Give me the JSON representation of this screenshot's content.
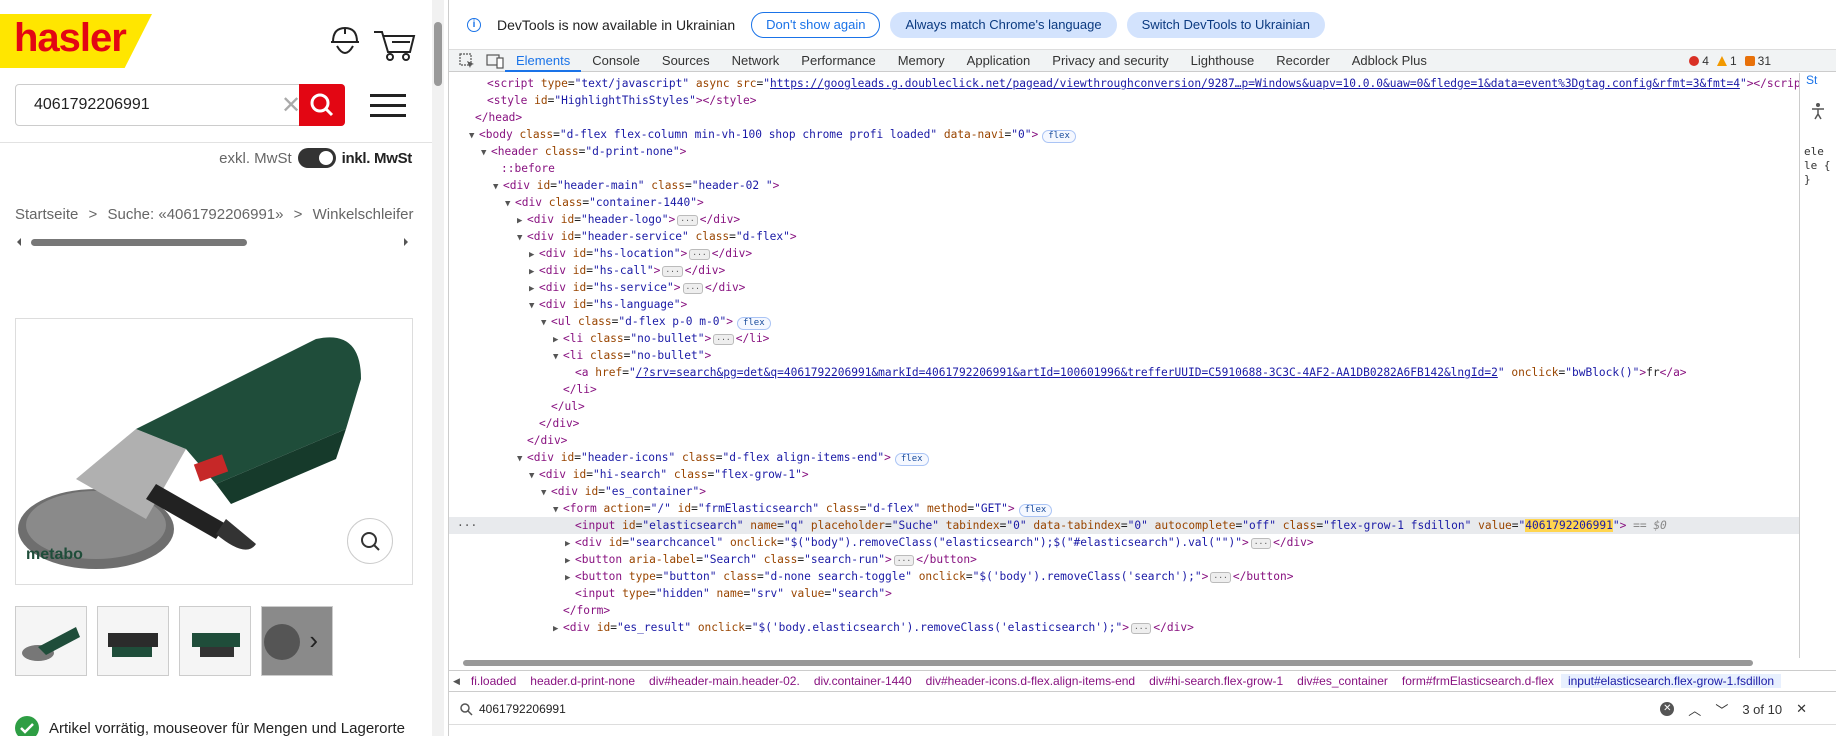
{
  "shop": {
    "logo_text": "hasler",
    "search_value": "4061792206991",
    "vat_exclusive": "exkl. MwSt",
    "vat_inclusive": "inkl. MwSt",
    "breadcrumbs": [
      "Startseite",
      ">",
      "Suche: «4061792206991»",
      ">",
      "Winkelschleifer Al"
    ],
    "stock_text": "Artikel vorrätig, mouseover für Mengen und Lagerorte",
    "brand_on_product": "metabo"
  },
  "devtools": {
    "info_text": "DevTools is now available in Ukrainian",
    "info_buttons": [
      "Don't show again",
      "Always match Chrome's language",
      "Switch DevTools to Ukrainian"
    ],
    "tabs": [
      "Elements",
      "Console",
      "Sources",
      "Network",
      "Performance",
      "Memory",
      "Application",
      "Privacy and security",
      "Lighthouse",
      "Recorder",
      "Adblock Plus"
    ],
    "error_count": "4",
    "warning_count": "1",
    "issue_count": "31",
    "side_tab": "St",
    "side_lines": [
      "ele",
      "le {",
      "}"
    ],
    "breadcrumb_path": [
      "fi.loaded",
      "header.d-print-none",
      "div#header-main.header-02.",
      "div.container-1440",
      "div#header-icons.d-flex.align-items-end",
      "div#hi-search.flex-grow-1",
      "div#es_container",
      "form#frmElasticsearch.d-flex",
      "input#elasticsearch.flex-grow-1.fsdillon"
    ],
    "find_value": "4061792206991",
    "find_count": "3 of 10",
    "flex_badge": "flex",
    "dollar_zero": "== $0"
  },
  "dom": {
    "l0_src": "https://googleads.g.doubleclick.net/pagead/viewthroughconversion/9287…p=Windows&uapv=10.0.0&uaw=0&fledge=1&data=event%3Dgtag.config&rfmt=3&fmt=4",
    "l1_id": "HighlightThisStyles",
    "body_class": "d-flex flex-column min-vh-100 shop chrome profi loaded",
    "body_navi": "0",
    "header_class": "d-print-none",
    "before": "::before",
    "hm_id": "header-main",
    "hm_class": "header-02 ",
    "cont_class": "container-1440",
    "hlogo_id": "header-logo",
    "hserv_id": "header-service",
    "hserv_class": "d-flex",
    "hsloc": "hs-location",
    "hscall": "hs-call",
    "hsserv": "hs-service",
    "hslang": "hs-language",
    "ul_class": "d-flex p-0 m-0",
    "li_class": "no-bullet",
    "a_href": "/?srv=search&pg=det&q=4061792206991&markId=4061792206991&artId=100601996&trefferUUID=C5910688-3C3C-4AF2-AA1DB0282A6FB142&lngId=2",
    "a_onclick": "bwBlock()",
    "a_text": "fr",
    "hicons_id": "header-icons",
    "hicons_class": "d-flex align-items-end",
    "hisearch_id": "hi-search",
    "hisearch_class": "flex-grow-1",
    "esc_id": "es_container",
    "form_action": "/",
    "form_id": "frmElasticsearch",
    "form_class": "d-flex",
    "form_method": "GET",
    "in_id": "elasticsearch",
    "in_name": "q",
    "in_ph": "Suche",
    "in_tab": "0",
    "in_dtab": "0",
    "in_ac": "off",
    "in_class": "flex-grow-1 fsdillon",
    "in_value": "4061792206991",
    "sc_id": "searchcancel",
    "sc_onclick": "$(\"body\").removeClass(\"elasticsearch\");$(\"#elasticsearch\").val(\"\")",
    "b1_aria": "Search",
    "b1_class": "search-run",
    "b2_type": "button",
    "b2_class": "d-none search-toggle",
    "b2_onclick": "$('body').removeClass('search');",
    "hid_type": "hidden",
    "hid_name": "srv",
    "hid_value": "search",
    "res_id": "es_result",
    "res_onclick": "$('body.elasticsearch').removeClass('elasticsearch');"
  }
}
